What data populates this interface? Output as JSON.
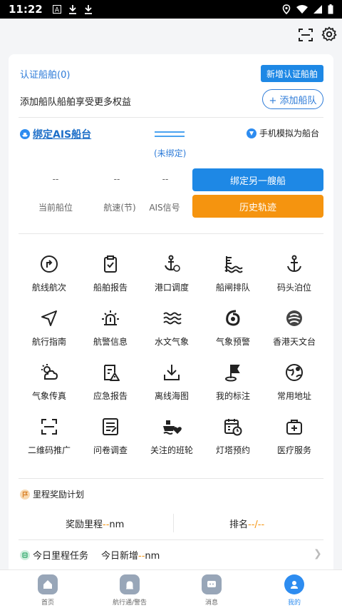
{
  "status_bar": {
    "time": "11:22"
  },
  "certified": {
    "title": "认证船舶(0)",
    "add_button": "新增认证船舶",
    "fleet_text": "添加船队船舶享受更多权益",
    "add_fleet_button": "+ 添加船队"
  },
  "ais": {
    "bind_label": "绑定AIS船台",
    "unbound": "(未绑定)",
    "simulate_label": "手机模拟为船台",
    "stats": [
      {
        "value": "--",
        "label": "当前船位"
      },
      {
        "value": "--",
        "label": "航速(节)"
      },
      {
        "value": "--",
        "label": "AIS信号"
      }
    ],
    "bind_another_button": "绑定另一艘船",
    "history_button": "历史轨迹"
  },
  "features": [
    {
      "label": "航线航次",
      "icon": "route-icon"
    },
    {
      "label": "船舶报告",
      "icon": "clipboard-check-icon"
    },
    {
      "label": "港口调度",
      "icon": "anchor-dispatch-icon"
    },
    {
      "label": "船闸排队",
      "icon": "lock-queue-icon"
    },
    {
      "label": "码头泊位",
      "icon": "anchor-icon"
    },
    {
      "label": "航行指南",
      "icon": "navigation-arrow-icon"
    },
    {
      "label": "航警信息",
      "icon": "alarm-light-icon"
    },
    {
      "label": "水文气象",
      "icon": "waves-icon"
    },
    {
      "label": "气象预警",
      "icon": "typhoon-icon"
    },
    {
      "label": "香港天文台",
      "icon": "observatory-icon"
    },
    {
      "label": "气象传真",
      "icon": "cloud-sun-icon"
    },
    {
      "label": "应急报告",
      "icon": "emergency-report-icon"
    },
    {
      "label": "离线海图",
      "icon": "download-icon"
    },
    {
      "label": "我的标注",
      "icon": "flag-marker-icon"
    },
    {
      "label": "常用地址",
      "icon": "globe-pin-icon"
    },
    {
      "label": "二维码推广",
      "icon": "qr-scan-icon"
    },
    {
      "label": "问卷调查",
      "icon": "survey-icon"
    },
    {
      "label": "关注的班轮",
      "icon": "ship-heart-icon"
    },
    {
      "label": "灯塔预约",
      "icon": "calendar-clock-icon"
    },
    {
      "label": "医疗服务",
      "icon": "medical-kit-icon"
    }
  ],
  "mileage": {
    "title": "里程奖励计划",
    "reward_label": "奖励里程",
    "reward_value": "--",
    "reward_unit": "nm",
    "rank_label": "排名",
    "rank_value": "--/--",
    "task_label": "今日里程任务",
    "new_label": "今日新增",
    "new_value": "--",
    "new_unit": "nm"
  },
  "tabs": [
    {
      "label": "首页",
      "icon": "home-icon"
    },
    {
      "label": "航行通/警告",
      "icon": "alarm-icon"
    },
    {
      "label": "消息",
      "icon": "message-icon"
    },
    {
      "label": "我的",
      "icon": "person-icon"
    }
  ],
  "colors": {
    "primary": "#1e88e5",
    "accent": "#f5940f"
  }
}
